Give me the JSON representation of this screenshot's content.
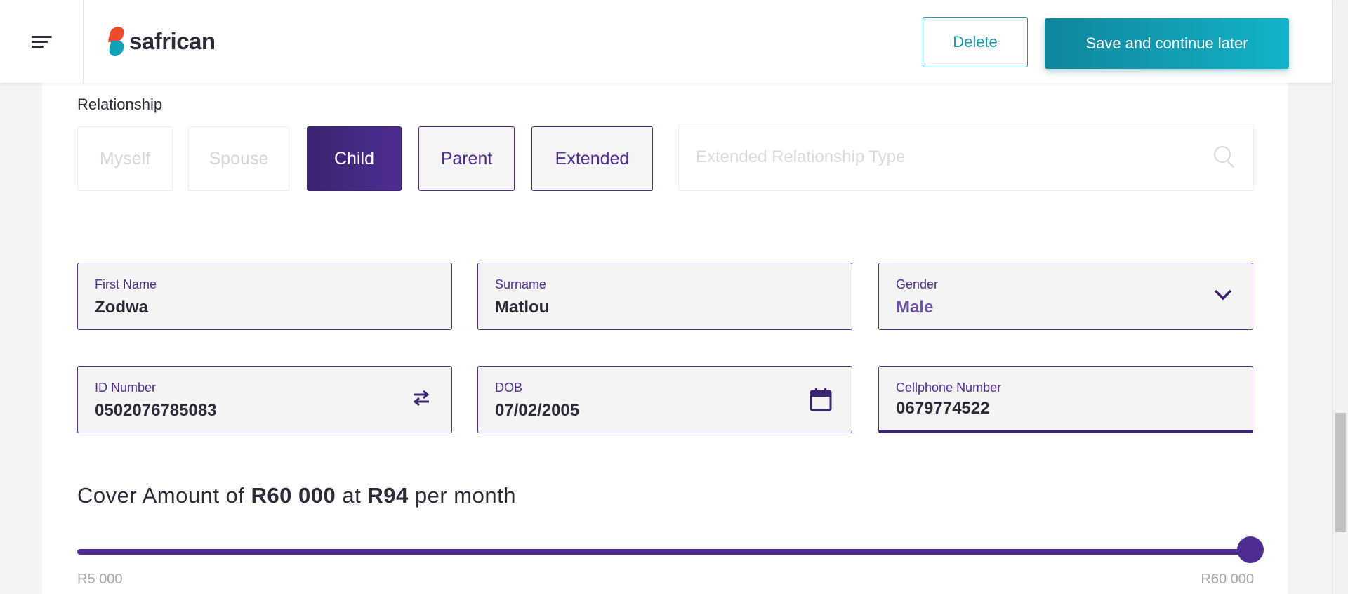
{
  "header": {
    "logo_text": "safrican",
    "delete_label": "Delete",
    "save_label": "Save and continue later"
  },
  "relationship": {
    "label": "Relationship",
    "options": [
      {
        "label": "Myself",
        "state": "disabled"
      },
      {
        "label": "Spouse",
        "state": "disabled"
      },
      {
        "label": "Child",
        "state": "selected"
      },
      {
        "label": "Parent",
        "state": "normal"
      },
      {
        "label": "Extended",
        "state": "normal"
      }
    ],
    "extended_placeholder": "Extended Relationship Type"
  },
  "form": {
    "first_name": {
      "label": "First Name",
      "value": "Zodwa"
    },
    "surname": {
      "label": "Surname",
      "value": "Matlou"
    },
    "gender": {
      "label": "Gender",
      "value": "Male"
    },
    "id_number": {
      "label": "ID Number",
      "value": "0502076785083"
    },
    "dob": {
      "label": "DOB",
      "value": "07/02/2005"
    },
    "cellphone": {
      "label": "Cellphone Number",
      "value": "0679774522"
    }
  },
  "cover": {
    "prefix": "Cover Amount of",
    "amount": "R60 000",
    "at": "at",
    "premium": "R94",
    "suffix": "per month",
    "slider_min": "R5 000",
    "slider_max": "R60 000",
    "slider_value_fraction": 1.0
  },
  "colors": {
    "primary_purple": "#4e2d92",
    "teal": "#12a4ba",
    "logo_red": "#ea4b2b"
  }
}
